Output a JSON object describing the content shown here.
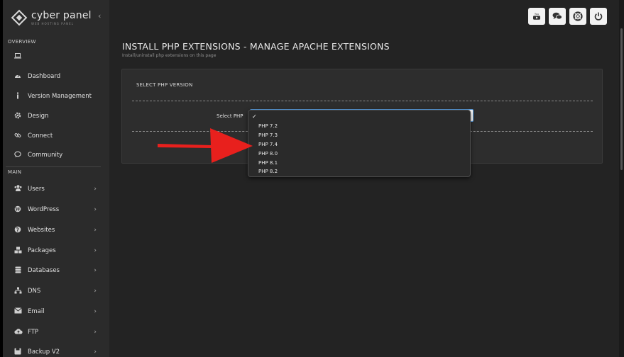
{
  "sidebar": {
    "logo_title": "cyber panel",
    "logo_subtitle": "WEB HOSTING PANEL",
    "collapse_glyph": "‹",
    "overview_label": "OVERVIEW",
    "main_label": "MAIN",
    "overview_items": [
      {
        "label": "",
        "icon": "laptop-icon"
      },
      {
        "label": "Dashboard",
        "icon": "dashboard-icon"
      },
      {
        "label": "Version Management",
        "icon": "info-icon"
      },
      {
        "label": "Design",
        "icon": "gear-icon"
      },
      {
        "label": "Connect",
        "icon": "link-icon"
      },
      {
        "label": "Community",
        "icon": "chat-icon"
      }
    ],
    "main_items": [
      {
        "label": "Users",
        "icon": "users-icon"
      },
      {
        "label": "WordPress",
        "icon": "wordpress-icon"
      },
      {
        "label": "Websites",
        "icon": "globe-icon"
      },
      {
        "label": "Packages",
        "icon": "packages-icon"
      },
      {
        "label": "Databases",
        "icon": "database-icon"
      },
      {
        "label": "DNS",
        "icon": "dns-icon"
      },
      {
        "label": "Email",
        "icon": "email-icon"
      },
      {
        "label": "FTP",
        "icon": "cloud-upload-icon"
      },
      {
        "label": "Backup V2",
        "icon": "backup-icon"
      }
    ],
    "chevron_glyph": "›"
  },
  "topbar": {
    "buttons": [
      {
        "name": "youtube-icon",
        "glyph": "▶"
      },
      {
        "name": "chat-bubbles-icon",
        "glyph": "💬"
      },
      {
        "name": "lifebuoy-icon",
        "glyph": "◎"
      },
      {
        "name": "power-icon",
        "glyph": "⏻"
      }
    ]
  },
  "page": {
    "title": "INSTALL PHP EXTENSIONS - MANAGE APACHE EXTENSIONS",
    "subtitle": "Install/uninstall php extensions on this page",
    "card_heading": "SELECT PHP VERSION",
    "select_label": "Select PHP"
  },
  "dropdown": {
    "check_glyph": "✓",
    "options": [
      "PHP 7.2",
      "PHP 7.3",
      "PHP 7.4",
      "PHP 8.0",
      "PHP 8.1",
      "PHP 8.2"
    ]
  },
  "colors": {
    "arrow": "#e8201d",
    "sidebar_bg": "#2b2b2b",
    "main_bg": "#232323",
    "select_border": "#5a9ee0"
  }
}
